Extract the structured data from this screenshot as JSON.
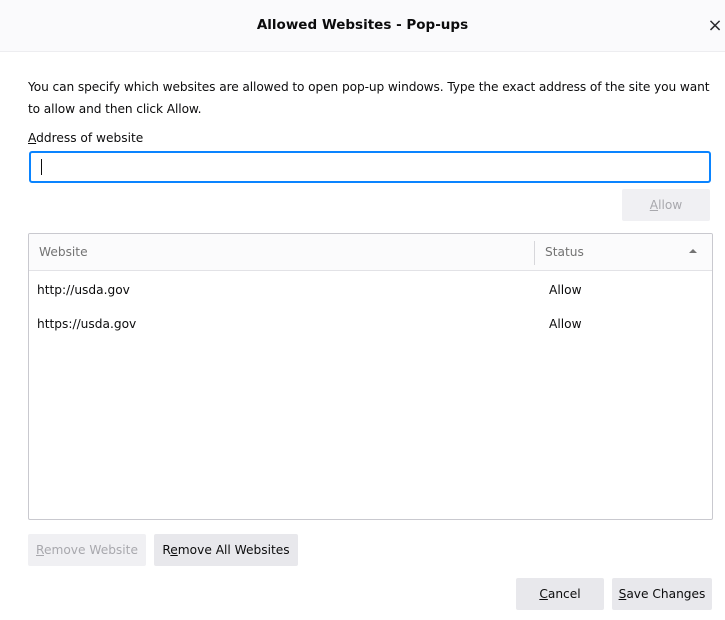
{
  "dialog": {
    "title": "Allowed Websites - Pop-ups",
    "close_glyph": "×"
  },
  "description": "You can specify which websites are allowed to open pop-up windows. Type the exact address of the site you want to allow and then click Allow.",
  "address": {
    "label_accesskey": "A",
    "label_rest": "ddress of website",
    "value": "",
    "placeholder": ""
  },
  "allow_button": {
    "accesskey": "A",
    "rest": "llow",
    "disabled": true
  },
  "table": {
    "columns": {
      "website": "Website",
      "status": "Status",
      "sort_icon": "sort-ascending-icon"
    },
    "rows": [
      {
        "website": "http://usda.gov",
        "status": "Allow"
      },
      {
        "website": "https://usda.gov",
        "status": "Allow"
      }
    ]
  },
  "buttons": {
    "remove_website": {
      "accesskey": "R",
      "rest": "emove Website",
      "disabled": true
    },
    "remove_all": {
      "accesskey": "e",
      "prefix": "R",
      "rest": "move All Websites"
    },
    "cancel": {
      "accesskey": "C",
      "rest": "ancel"
    },
    "save": {
      "accesskey": "S",
      "rest": "ave Changes"
    }
  },
  "colors": {
    "focus_ring": "#0a84ff",
    "button_bg": "#e8e8ec",
    "disabled_text": "#a8a8ad"
  }
}
